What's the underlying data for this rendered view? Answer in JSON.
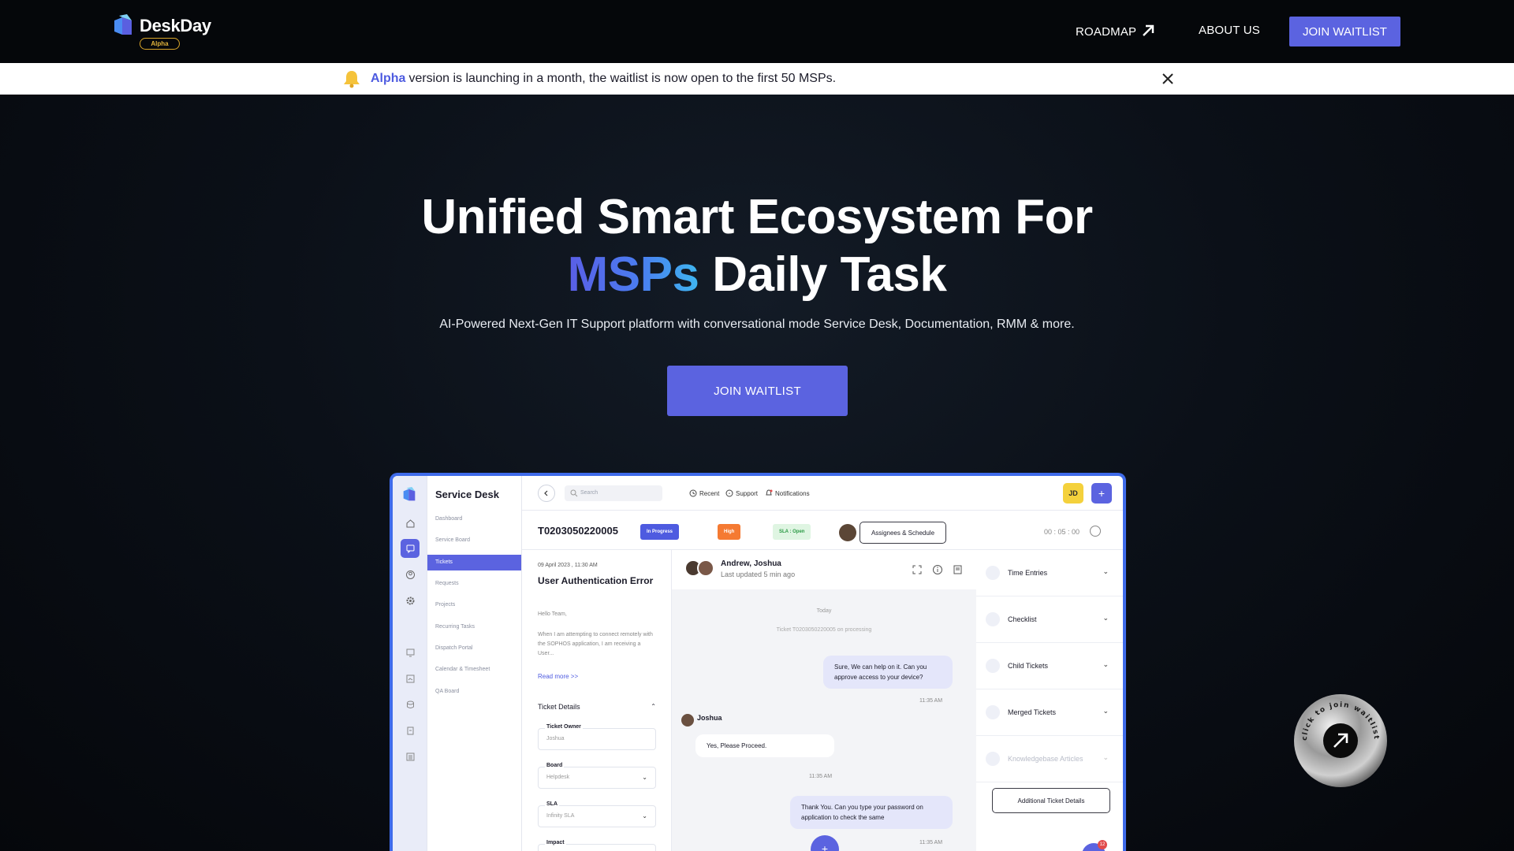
{
  "brand": {
    "name": "DeskDay",
    "badge": "Alpha",
    "accent": "#5b63e0"
  },
  "nav": {
    "roadmap": "ROADMAP",
    "about": "ABOUT US",
    "join": "JOIN WAITLIST"
  },
  "announcement": {
    "highlight": "Alpha",
    "text": "version is launching in a month, the waitlist is now open to the first 50 MSPs."
  },
  "hero": {
    "line1": "Unified Smart Ecosystem For",
    "highlight": "MSPs",
    "line2_rest": "Daily Task",
    "subtitle": "AI-Powered Next-Gen IT Support platform with conversational mode Service Desk, Documentation, RMM & more.",
    "cta": "JOIN WAITLIST"
  },
  "app": {
    "module_title": "Service Desk",
    "menu": [
      "Dashboard",
      "Service Board",
      "Tickets",
      "Requests",
      "Projects",
      "Recurring Tasks",
      "Dispatch Portal",
      "Calendar & Timesheet",
      "QA Board"
    ],
    "active_menu": "Tickets",
    "header": {
      "search_placeholder": "Search",
      "recent": "Recent",
      "support": "Support",
      "notifications": "Notifications",
      "user_initials": "JD",
      "plus": "+"
    },
    "ticket": {
      "id": "T0203050220005",
      "status": "In Progress",
      "priority": "High",
      "sla": "SLA : Open",
      "assign_button": "Assignees & Schedule",
      "timer": "00 : 05 : 00"
    },
    "detail": {
      "date": "09 April 2023 , 11:30 AM",
      "title": "User Authentication Error",
      "greeting": "Hello Team,",
      "body": "When I am attempting to connect remotely with the SOPHOS application, I am receiving a User...",
      "read_more": "Read more >>",
      "section": "Ticket Details",
      "fields": [
        {
          "label": "Ticket Owner",
          "value": "Joshua"
        },
        {
          "label": "Board",
          "value": "Helpdesk"
        },
        {
          "label": "SLA",
          "value": "Infinity SLA"
        },
        {
          "label": "Impact",
          "value": ""
        }
      ]
    },
    "chat": {
      "participants": "Andrew, Joshua",
      "updated": "Last updated  5 min ago",
      "day": "Today",
      "system": "Ticket T0203050220005 on processing",
      "messages": [
        {
          "text": "Sure, We can help on it. Can you approve access to your device?",
          "time": "11:35 AM"
        },
        {
          "sender": "Joshua",
          "text": "Yes, Please Proceed.",
          "time": "11:35 AM"
        },
        {
          "text": "Thank You. Can you type your password on application to check the same",
          "time": "11:35 AM"
        }
      ],
      "fab": "+"
    },
    "side": {
      "rows": [
        "Time Entries",
        "Checklist",
        "Child Tickets",
        "Merged Tickets",
        "Knowledgebase Articles"
      ],
      "button": "Additional Ticket Details",
      "notif_count": "12"
    }
  },
  "floating_badge": {
    "text": "click to join waitlist"
  }
}
